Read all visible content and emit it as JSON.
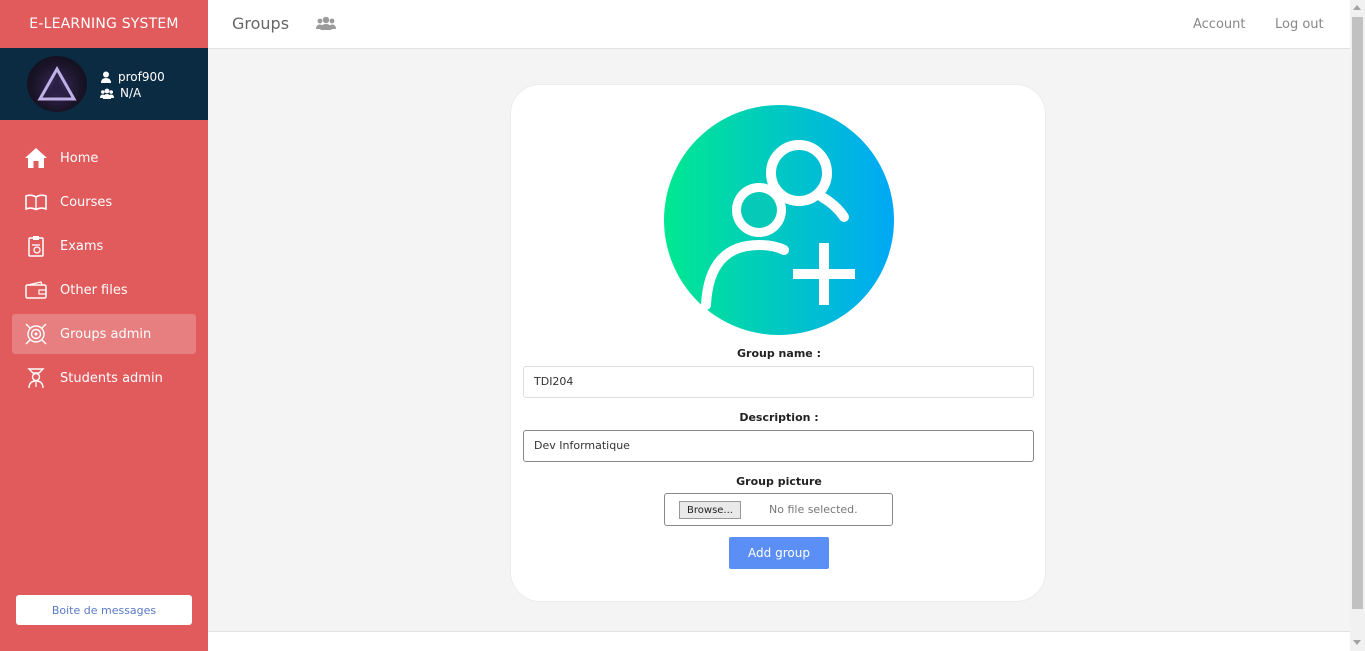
{
  "sidebar": {
    "brand": "E-LEARNING SYSTEM",
    "user": {
      "name": "prof900",
      "group": "N/A"
    },
    "items": [
      {
        "label": "Home",
        "icon": "home-icon"
      },
      {
        "label": "Courses",
        "icon": "book-icon"
      },
      {
        "label": "Exams",
        "icon": "clipboard-icon"
      },
      {
        "label": "Other files",
        "icon": "wallet-icon"
      },
      {
        "label": "Groups admin",
        "icon": "target-icon",
        "active": true
      },
      {
        "label": "Students admin",
        "icon": "student-icon"
      }
    ],
    "message_button": "Boite de messages"
  },
  "header": {
    "title": "Groups",
    "title_icon": "users-icon",
    "account": "Account",
    "logout": "Log out"
  },
  "form": {
    "picture_icon": "add-group-icon",
    "group_name_label": "Group name :",
    "group_name_value": "TDI204",
    "description_label": "Description :",
    "description_value": "Dev Informatique",
    "picture_label": "Group picture",
    "browse_label": "Browse...",
    "file_status": "No file selected.",
    "submit_label": "Add group"
  },
  "colors": {
    "sidebar": "#e15a5c",
    "user_box": "#0b2b42",
    "accent_button": "#5b8ff6",
    "gradient_start": "#00e890",
    "gradient_end": "#00a8f6"
  }
}
